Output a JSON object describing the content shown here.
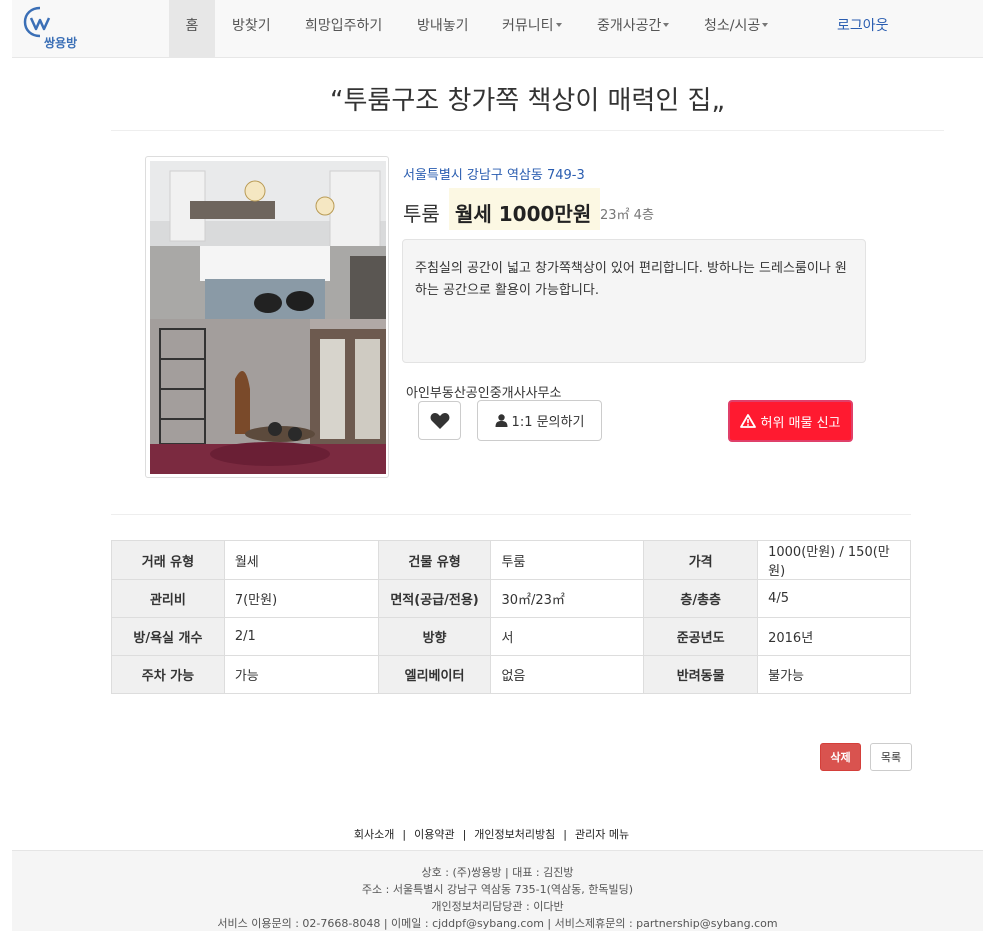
{
  "nav": {
    "logo_text": "쌍용방",
    "items": [
      "홈",
      "방찾기",
      "희망입주하기",
      "방내놓기",
      "커뮤니티",
      "중개사공간",
      "청소/시공"
    ],
    "logout": "로그아웃"
  },
  "listing": {
    "title": "“투룸구조 창가쪽 책상이 매력인 집„",
    "address": "서울특별시 강남구 역삼동 749-3",
    "room_type": "투룸",
    "price": "월세 1000만원",
    "size_floor": "23㎡ 4층",
    "description": " 주침실의 공간이 넓고 창가쪽책상이 있어 편리합니다.  방하나는 드레스룸이나 원하는 공간으로 활용이 가능합니다.",
    "agency": "아인부동산공인중개사사무소",
    "inquiry_label": "1:1 문의하기",
    "report_label": "허위 매물 신고"
  },
  "details": [
    [
      {
        "label": "거래 유형",
        "value": "월세"
      },
      {
        "label": "건물 유형",
        "value": "투룸"
      },
      {
        "label": "가격",
        "value": "1000(만원) / 150(만원)"
      }
    ],
    [
      {
        "label": "관리비",
        "value": "7(만원)"
      },
      {
        "label": "면적(공급/전용)",
        "value": "30㎡/23㎡"
      },
      {
        "label": "층/총층",
        "value": "4/5"
      }
    ],
    [
      {
        "label": "방/욕실 개수",
        "value": "2/1"
      },
      {
        "label": "방향",
        "value": "서"
      },
      {
        "label": "준공년도",
        "value": "2016년"
      }
    ],
    [
      {
        "label": "주차 가능",
        "value": "가능"
      },
      {
        "label": "엘리베이터",
        "value": "없음"
      },
      {
        "label": "반려동물",
        "value": "불가능"
      }
    ]
  ],
  "actions": {
    "delete": "삭제",
    "list": "목록"
  },
  "footer": {
    "links": [
      "회사소개",
      "이용약관",
      "개인정보처리방침",
      "관리자 메뉴"
    ],
    "company": "상호 : (주)쌍용방 | 대표 : 김진방",
    "address": "주소 : 서울특별시 강남구 역삼동 735-1(역삼동, 한독빌딩)",
    "privacy_officer": "개인정보처리담당관 : 이다반",
    "contact": "서비스 이용문의 : 02-7668-8048 | 이메일 : cjddpf@sybang.com | 서비스제휴문의 : partnership@sybang.com"
  },
  "colors": {
    "brand": "#2a5db0",
    "report": "#ff1a30",
    "delete": "#d9534f",
    "price_highlight": "#fcf8e3"
  }
}
